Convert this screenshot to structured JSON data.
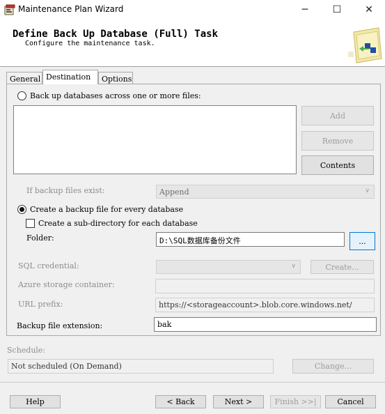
{
  "window": {
    "title": "Maintenance Plan Wizard",
    "minimize": "─",
    "maximize": "☐",
    "close": "✕"
  },
  "header": {
    "title": "Define Back Up Database (Full) Task",
    "subtitle": "Configure the maintenance task."
  },
  "tabs": [
    "General",
    "Destination",
    "Options"
  ],
  "destination": {
    "across_files_label": "Back up databases across one or more files:",
    "add_label": "Add",
    "remove_label": "Remove",
    "contents_label": "Contents",
    "if_exist_label": "If backup files exist:",
    "if_exist_value": "Append",
    "create_per_db_label": "Create a backup file for every database",
    "subdir_label": "Create a sub-directory for each database",
    "folder_label": "Folder:",
    "folder_value": "D:\\SQL数据库备份文件",
    "browse_label": "...",
    "sql_credential_label": "SQL credential:",
    "create_label": "Create...",
    "azure_container_label": "Azure storage container:",
    "url_prefix_label": "URL prefix:",
    "url_prefix_value": "https://<storageaccount>.blob.core.windows.net/",
    "extension_label": "Backup file extension:",
    "extension_value": "bak"
  },
  "schedule": {
    "label": "Schedule:",
    "value": "Not scheduled (On Demand)",
    "change_label": "Change..."
  },
  "footer": {
    "help": "Help",
    "back": "< Back",
    "next": "Next >",
    "finish": "Finish >>|",
    "cancel": "Cancel"
  }
}
